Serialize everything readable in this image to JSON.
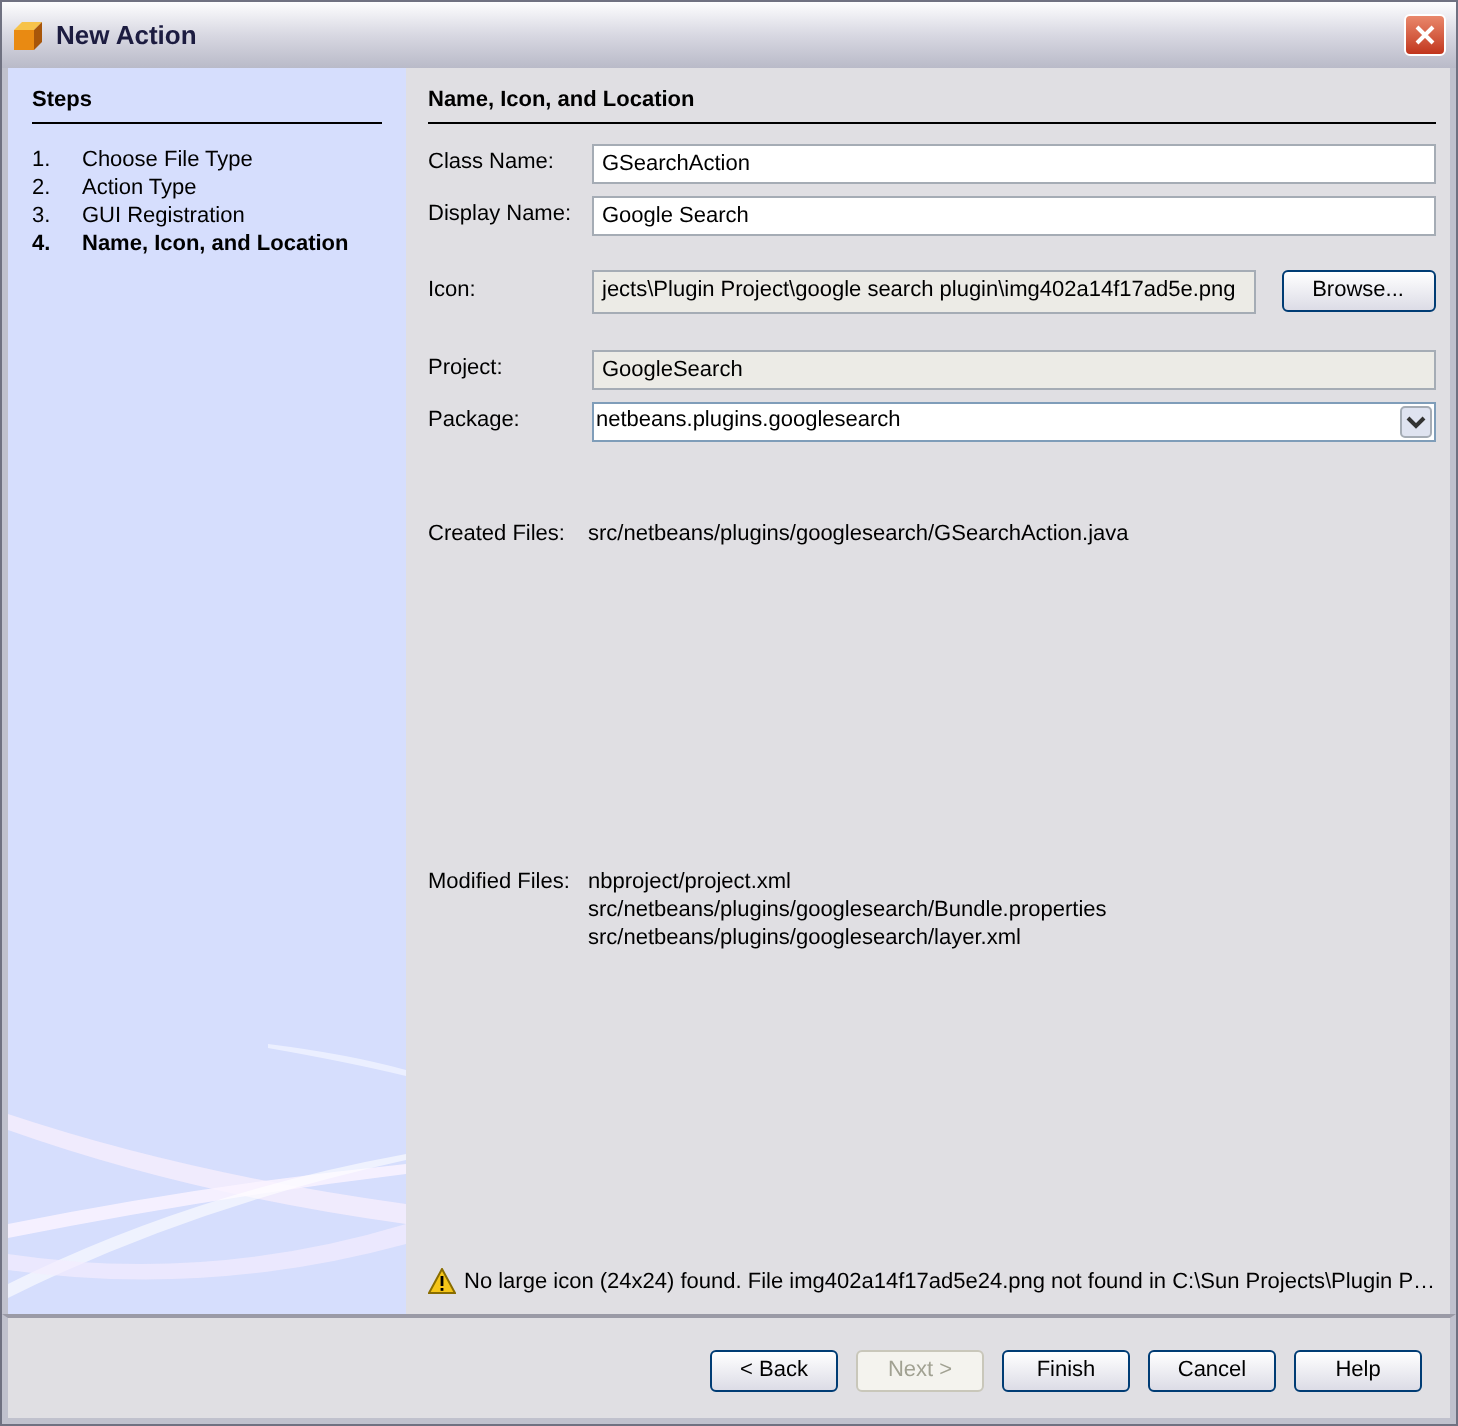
{
  "window": {
    "title": "New Action"
  },
  "steps": {
    "title": "Steps",
    "items": [
      {
        "number": "1.",
        "label": "Choose File Type",
        "selected": false
      },
      {
        "number": "2.",
        "label": "Action Type",
        "selected": false
      },
      {
        "number": "3.",
        "label": "GUI Registration",
        "selected": false
      },
      {
        "number": "4.",
        "label": "Name, Icon, and Location",
        "selected": true
      }
    ]
  },
  "panel": {
    "title": "Name, Icon, and Location",
    "class_name": {
      "label": "Class Name:",
      "value": "GSearchAction"
    },
    "display_name": {
      "label": "Display Name:",
      "value": "Google Search"
    },
    "icon": {
      "label": "Icon:",
      "value": "jects\\Plugin Project\\google search plugin\\img402a14f17ad5e.png",
      "button": "Browse..."
    },
    "project": {
      "label": "Project:",
      "value": "GoogleSearch"
    },
    "package": {
      "label": "Package:",
      "value": "netbeans.plugins.googlesearch"
    },
    "created_files": {
      "label": "Created Files:",
      "files": [
        "src/netbeans/plugins/googlesearch/GSearchAction.java"
      ]
    },
    "modified_files": {
      "label": "Modified Files:",
      "files": [
        "nbproject/project.xml",
        "src/netbeans/plugins/googlesearch/Bundle.properties",
        "src/netbeans/plugins/googlesearch/layer.xml"
      ]
    },
    "warning": "No large icon (24x24) found. File img402a14f17ad5e24.png not found in C:\\Sun Projects\\Plugin P…"
  },
  "buttons": [
    {
      "label": "< Back",
      "disabled": false
    },
    {
      "label": "Next >",
      "disabled": true
    },
    {
      "label": "Finish",
      "disabled": false
    },
    {
      "label": "Cancel",
      "disabled": false
    },
    {
      "label": "Help",
      "disabled": false
    }
  ]
}
